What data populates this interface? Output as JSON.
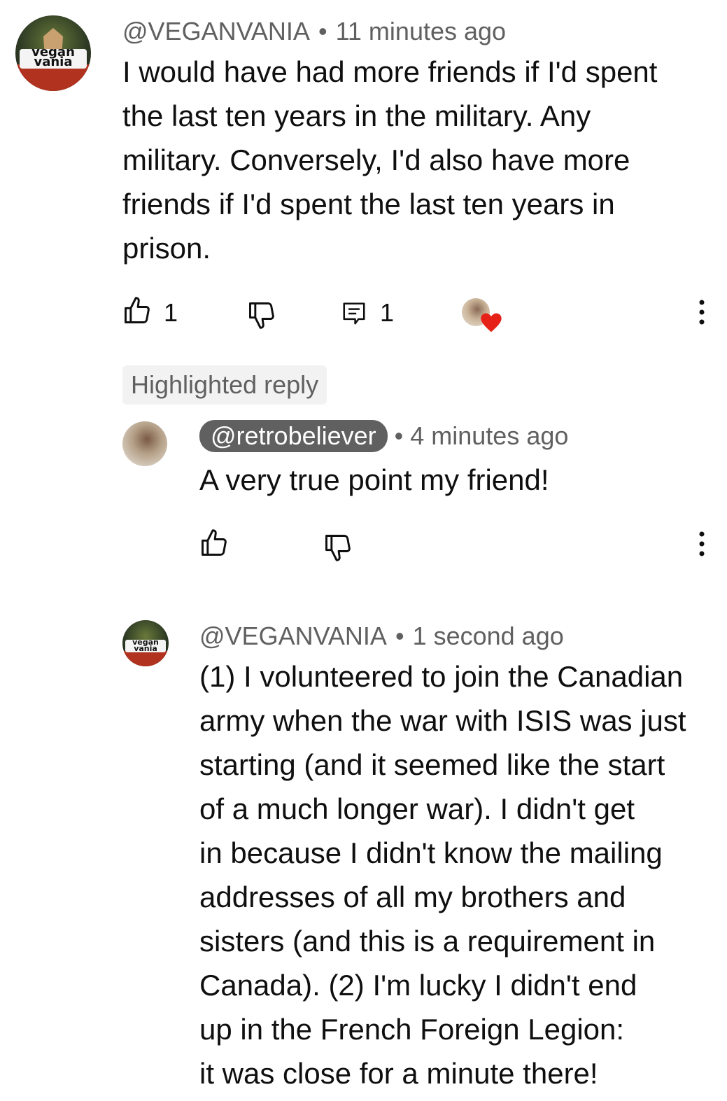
{
  "comment": {
    "author": "@VEGANVANIA",
    "time": "11 minutes ago",
    "avatar_text_1": "vegan",
    "avatar_text_2": "vania",
    "lines": [
      "I would have had more friends if I'd spent",
      "the last ten years in the military.  Any",
      "military.  Conversely, I'd also have more",
      "friends if I'd spent the last ten years in",
      "prison."
    ],
    "likes": "1",
    "replies": "1",
    "icons": [
      "thumbs-up-icon",
      "thumbs-down-icon",
      "reply-icon",
      "creator-heart-icon",
      "more-vertical-icon"
    ]
  },
  "highlighted_label": "Highlighted reply",
  "reply1": {
    "author": "@retrobeliever",
    "time": "4 minutes ago",
    "text": "A very true point my friend!"
  },
  "reply2": {
    "author": "@VEGANVANIA",
    "time": "1 second ago",
    "lines": [
      "(1) I volunteered to join the Canadian",
      "army when the war with ISIS was just",
      "starting (and it seemed like the start",
      "of a much longer war).  I didn't get",
      "in because I didn't know the mailing",
      "addresses of all my brothers and",
      "sisters (and this is a requirement in",
      "Canada).  (2) I'm lucky I didn't end",
      "up in the French Foreign Legion:",
      "it was close for a minute there!"
    ]
  },
  "colors": {
    "meta": "#606060",
    "heart": "#e62117",
    "pill": "#606060"
  }
}
